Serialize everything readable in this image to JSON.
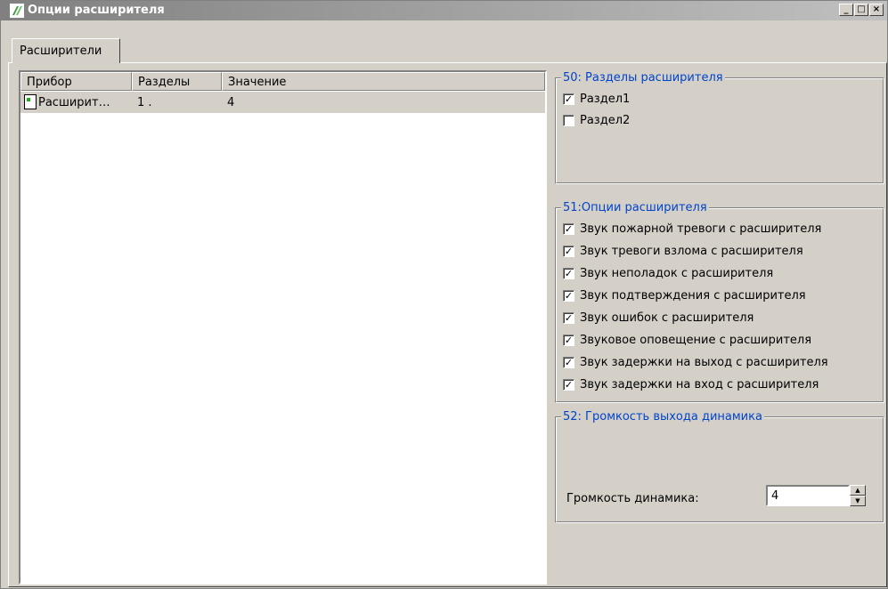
{
  "window": {
    "title": "Опции расширителя",
    "icon": "app-logo-icon",
    "controls": [
      "_",
      "□",
      "×"
    ]
  },
  "tabs": [
    {
      "label": "Расширители",
      "active": true
    }
  ],
  "list": {
    "columns": [
      "Прибор",
      "Разделы",
      "Значение"
    ],
    "rows": [
      {
        "device": "Расширит…",
        "sections": "1 .",
        "value": "4",
        "selected": true
      }
    ]
  },
  "group50": {
    "title": "50: Разделы расширителя",
    "items": [
      {
        "label": "Раздел1",
        "checked": true
      },
      {
        "label": "Раздел2",
        "checked": false
      }
    ]
  },
  "group51": {
    "title": "51:Опции расширителя",
    "items": [
      {
        "label": "Звук пожарной тревоги с расширителя",
        "checked": true
      },
      {
        "label": "Звук тревоги взлома с расширителя",
        "checked": true
      },
      {
        "label": "Звук неполадок с расширителя",
        "checked": true
      },
      {
        "label": "Звук подтверждения с расширителя",
        "checked": true
      },
      {
        "label": "Звук ошибок с расширителя",
        "checked": true
      },
      {
        "label": "Звуковое оповещение с расширителя",
        "checked": true
      },
      {
        "label": "Звук задержки на выход с расширителя",
        "checked": true
      },
      {
        "label": "Звук задержки на вход с расширителя",
        "checked": true
      }
    ]
  },
  "group52": {
    "title": "52: Громкость выхода динамика",
    "label": "Громкость динамика:",
    "value": "4"
  }
}
